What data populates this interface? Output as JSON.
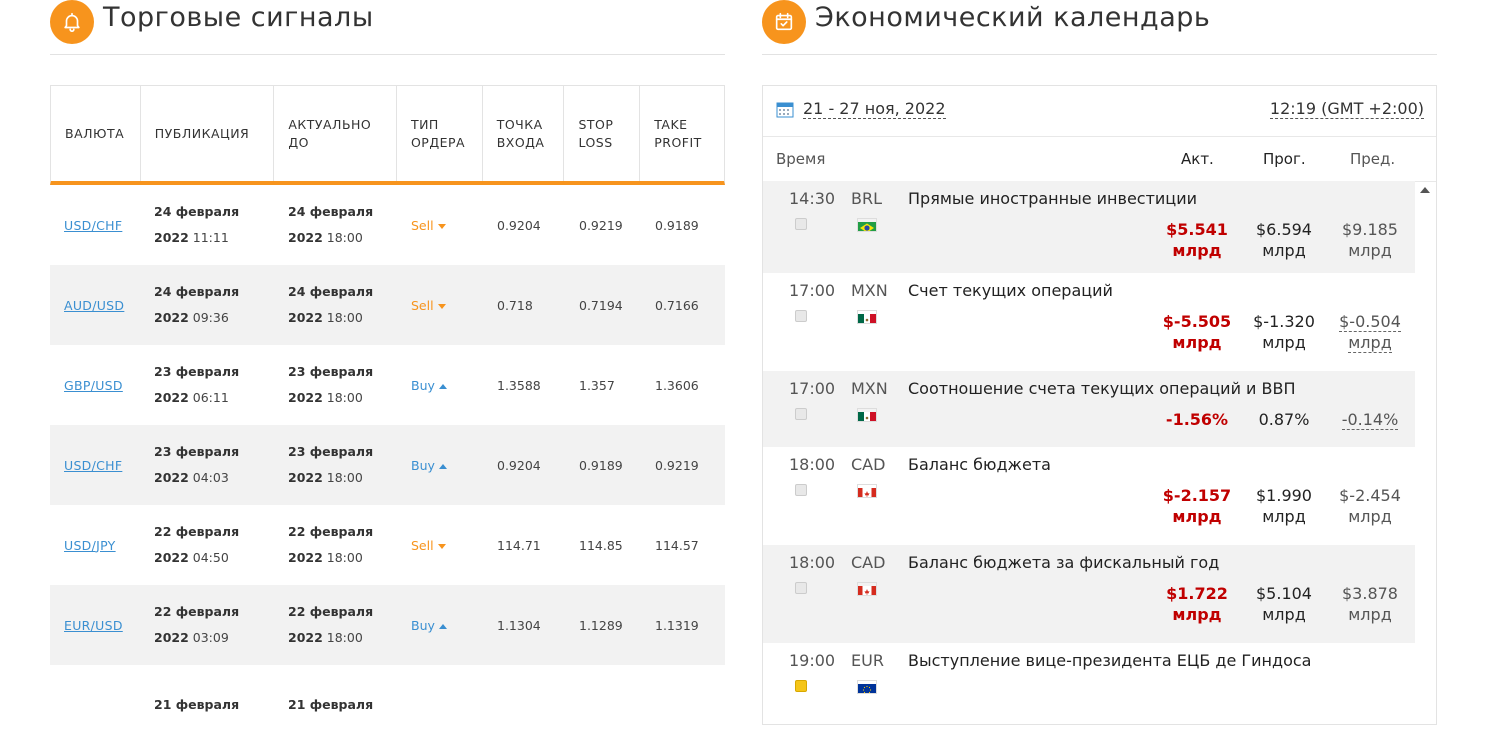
{
  "signals_section": {
    "title": "Торговые сигналы",
    "icon": "bell-icon",
    "accent": "#f7941d",
    "columns": [
      "ВАЛЮТА",
      "ПУБЛИКАЦИЯ",
      "АКТУАЛЬНО ДО",
      "ТИП ОРДЕРА",
      "ТОЧКА ВХОДА",
      "STOP LOSS",
      "TAKE PROFIT"
    ],
    "rows": [
      {
        "pair": "USD/CHF",
        "pub_date": "24 февраля",
        "pub_year": "2022",
        "pub_time": "11:11",
        "act_date": "24 февраля",
        "act_year": "2022",
        "act_time": "18:00",
        "type": "Sell",
        "entry": "0.9204",
        "sl": "0.9219",
        "tp": "0.9189"
      },
      {
        "pair": "AUD/USD",
        "pub_date": "24 февраля",
        "pub_year": "2022",
        "pub_time": "09:36",
        "act_date": "24 февраля",
        "act_year": "2022",
        "act_time": "18:00",
        "type": "Sell",
        "entry": "0.718",
        "sl": "0.7194",
        "tp": "0.7166"
      },
      {
        "pair": "GBP/USD",
        "pub_date": "23 февраля",
        "pub_year": "2022",
        "pub_time": "06:11",
        "act_date": "23 февраля",
        "act_year": "2022",
        "act_time": "18:00",
        "type": "Buy",
        "entry": "1.3588",
        "sl": "1.357",
        "tp": "1.3606"
      },
      {
        "pair": "USD/CHF",
        "pub_date": "23 февраля",
        "pub_year": "2022",
        "pub_time": "04:03",
        "act_date": "23 февраля",
        "act_year": "2022",
        "act_time": "18:00",
        "type": "Buy",
        "entry": "0.9204",
        "sl": "0.9189",
        "tp": "0.9219"
      },
      {
        "pair": "USD/JPY",
        "pub_date": "22 февраля",
        "pub_year": "2022",
        "pub_time": "04:50",
        "act_date": "22 февраля",
        "act_year": "2022",
        "act_time": "18:00",
        "type": "Sell",
        "entry": "114.71",
        "sl": "114.85",
        "tp": "114.57"
      },
      {
        "pair": "EUR/USD",
        "pub_date": "22 февраля",
        "pub_year": "2022",
        "pub_time": "03:09",
        "act_date": "22 февраля",
        "act_year": "2022",
        "act_time": "18:00",
        "type": "Buy",
        "entry": "1.1304",
        "sl": "1.1289",
        "tp": "1.1319"
      },
      {
        "pair": "",
        "pub_date": "21 февраля",
        "pub_year": "",
        "pub_time": "",
        "act_date": "21 февраля",
        "act_year": "",
        "act_time": "",
        "type": "",
        "entry": "",
        "sl": "",
        "tp": ""
      }
    ]
  },
  "calendar_section": {
    "title": "Экономический календарь",
    "icon": "calendar-check-icon",
    "date_range": "21 - 27 ноя, 2022",
    "clock": "12:19 (GMT +2:00)",
    "col_time": "Время",
    "col_actual": "Акт.",
    "col_forecast": "Прог.",
    "col_previous": "Пред.",
    "events": [
      {
        "time": "14:30",
        "currency": "BRL",
        "flag": "brazil-flag-icon",
        "title": "Прямые иностранные инвестиции",
        "actual": "$5.541",
        "actual_unit": "млрд",
        "forecast": "$6.594",
        "forecast_unit": "млрд",
        "previous": "$9.185",
        "previous_unit": "млрд",
        "important": false
      },
      {
        "time": "17:00",
        "currency": "MXN",
        "flag": "mexico-flag-icon",
        "title": "Счет текущих операций",
        "actual": "$-5.505",
        "actual_unit": "млрд",
        "forecast": "$-1.320",
        "forecast_unit": "млрд",
        "previous": "$-0.504",
        "previous_unit": "млрд",
        "important": false
      },
      {
        "time": "17:00",
        "currency": "MXN",
        "flag": "mexico-flag-icon",
        "title": "Соотношение счета текущих операций и ВВП",
        "actual": "-1.56%",
        "actual_unit": "",
        "forecast": "0.87%",
        "forecast_unit": "",
        "previous": "-0.14%",
        "previous_unit": "",
        "important": false
      },
      {
        "time": "18:00",
        "currency": "CAD",
        "flag": "canada-flag-icon",
        "title": "Баланс бюджета",
        "actual": "$-2.157",
        "actual_unit": "млрд",
        "forecast": "$1.990",
        "forecast_unit": "млрд",
        "previous": "$-2.454",
        "previous_unit": "млрд",
        "important": false
      },
      {
        "time": "18:00",
        "currency": "CAD",
        "flag": "canada-flag-icon",
        "title": "Баланс бюджета за фискальный год",
        "actual": "$1.722",
        "actual_unit": "млрд",
        "forecast": "$5.104",
        "forecast_unit": "млрд",
        "previous": "$3.878",
        "previous_unit": "млрд",
        "important": false
      },
      {
        "time": "19:00",
        "currency": "EUR",
        "flag": "eu-flag-icon",
        "title": "Выступление вице-президента ЕЦБ де Гиндоса",
        "actual": "",
        "actual_unit": "",
        "forecast": "",
        "forecast_unit": "",
        "previous": "",
        "previous_unit": "",
        "important": true
      }
    ]
  }
}
